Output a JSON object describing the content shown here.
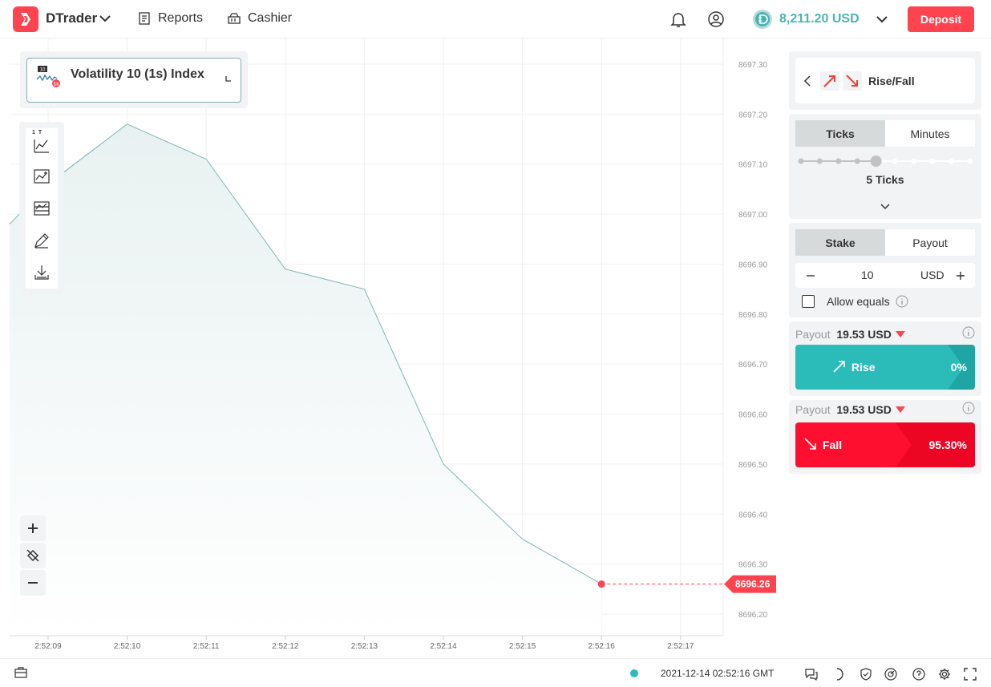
{
  "header": {
    "app_name": "DTrader",
    "nav": {
      "reports": "Reports",
      "cashier": "Cashier"
    },
    "balance": "8,211.20 USD",
    "deposit": "Deposit"
  },
  "chart": {
    "symbol": "Volatility 10 (1s) Index",
    "symbol_badge": "1s",
    "symbol_code": "10",
    "current_price": "8696.26",
    "y_ticks": [
      "8697.30",
      "8697.20",
      "8697.10",
      "8697.00",
      "8696.90",
      "8696.80",
      "8696.70",
      "8696.60",
      "8696.50",
      "8696.40",
      "8696.30",
      "8696.20"
    ],
    "x_ticks": [
      "2:52:09",
      "2:52:10",
      "2:52:11",
      "2:52:12",
      "2:52:13",
      "2:52:14",
      "2:52:15",
      "2:52:16",
      "2:52:17"
    ],
    "toolbar_label": "1 T"
  },
  "chart_data": {
    "type": "area",
    "x": [
      "2:52:08",
      "2:52:09",
      "2:52:10",
      "2:52:11",
      "2:52:12",
      "2:52:13",
      "2:52:14",
      "2:52:15",
      "2:52:16"
    ],
    "values": [
      8696.98,
      8697.06,
      8697.18,
      8697.11,
      8696.89,
      8696.85,
      8696.5,
      8696.35,
      8696.26
    ],
    "ylim": [
      8696.15,
      8697.33
    ],
    "grid": true
  },
  "trade": {
    "trade_type": "Rise/Fall",
    "duration_tabs": [
      "Ticks",
      "Minutes"
    ],
    "ticks_label": "5 Ticks",
    "ticks_selected": 5,
    "ticks_total": 10,
    "stake_tabs": [
      "Stake",
      "Payout"
    ],
    "stake_value": "10",
    "currency": "USD",
    "allow_equals": "Allow equals",
    "payout_label": "Payout",
    "rise": {
      "payout": "19.53 USD",
      "label": "Rise",
      "percent": "0%"
    },
    "fall": {
      "payout": "19.53 USD",
      "label": "Fall",
      "percent": "95.30%"
    }
  },
  "footer": {
    "datetime": "2021-12-14 02:52:16 GMT"
  },
  "colors": {
    "brand": "#ff444f",
    "rise": "#4bb4b3",
    "fall": "#ec3f3f",
    "line": "#7fb6b5"
  }
}
